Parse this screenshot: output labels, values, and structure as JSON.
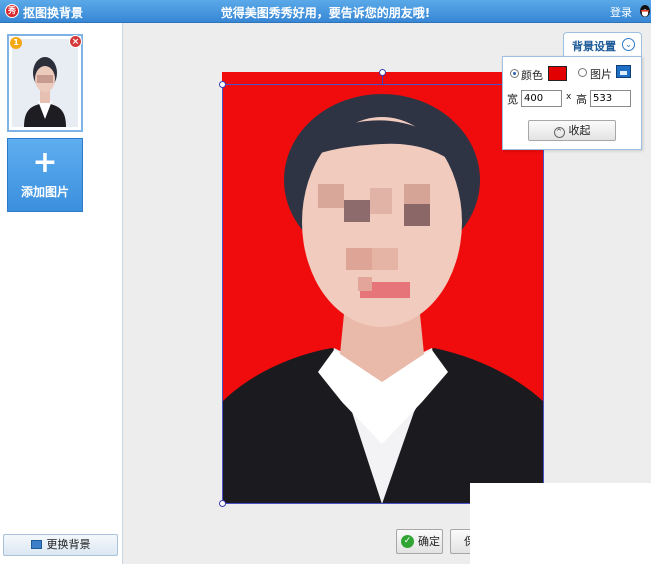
{
  "titlebar": {
    "app_logo": "秀",
    "title": "抠图换背景",
    "marquee": "觉得美图秀秀好用，要告诉您的朋友哦!",
    "login": "登录"
  },
  "sidebar": {
    "thumbnail_index": "1",
    "thumbnail_close": "×",
    "add_plus": "+",
    "add_label": "添加图片",
    "change_bg_label": "更换背景"
  },
  "bg_settings": {
    "tab_label": "背景设置",
    "tab_chevron": "⌄",
    "color_label": "颜色",
    "color_selected": true,
    "color_value": "#e30000",
    "picture_label": "图片",
    "picture_selected": false,
    "width_label": "宽",
    "width_value": "400",
    "times": "x",
    "height_label": "高",
    "height_value": "533",
    "collapse_icon": "^",
    "collapse_label": "收起"
  },
  "actions": {
    "ok_label": "确定",
    "other_label": "保存"
  },
  "colors": {
    "titlebar": "#3f8ddb",
    "accent": "#3b8fdd",
    "photo_bg": "#f00c0c",
    "selection": "#4b52c8"
  }
}
